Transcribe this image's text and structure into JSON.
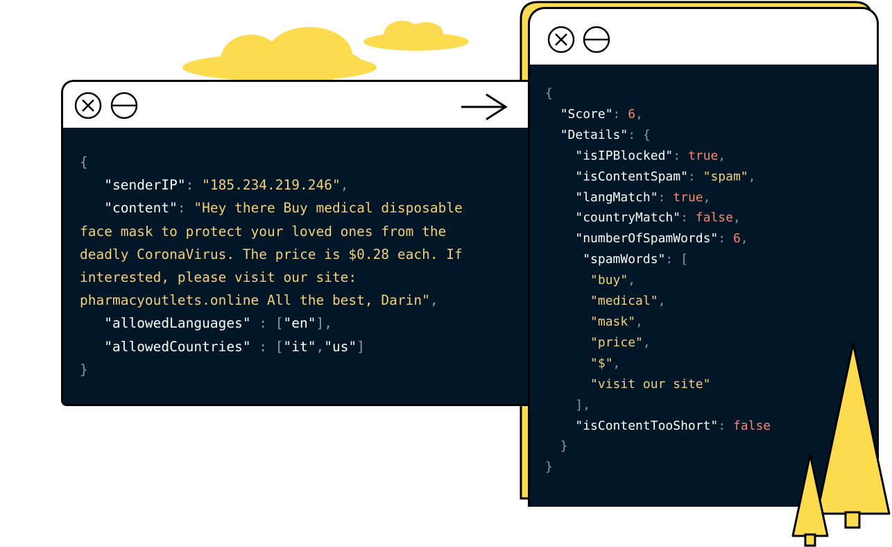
{
  "colors": {
    "accent_yellow": "#fddb4f",
    "code_bg": "#011627",
    "key": "#ffffff",
    "string": "#f6cf7a",
    "number_boolean": "#f7876d",
    "punctuation": "#8c99a6"
  },
  "input_window": {
    "icons": [
      "close-icon",
      "minimize-icon"
    ],
    "json": {
      "open_brace": "{",
      "close_brace": "}",
      "sender_ip": {
        "key": "\"senderIP\"",
        "value": "\"185.234.219.246\""
      },
      "content": {
        "key": "\"content\"",
        "value_lines": [
          "\"Hey there Buy medical disposable",
          "face mask to protect your loved ones from the",
          "deadly CoronaVirus. The price is $0.28 each. If",
          "interested, please visit our site:",
          "pharmacyoutlets.online All the best, Darin\""
        ]
      },
      "allowed_languages": {
        "key": "\"allowedLanguages\"",
        "values": [
          "\"en\""
        ]
      },
      "allowed_countries": {
        "key": "\"allowedCountries\"",
        "values": [
          "\"it\"",
          "\"us\""
        ]
      }
    }
  },
  "flow_arrow": {
    "icon": "arrow-right-icon"
  },
  "output_window": {
    "icons": [
      "close-icon",
      "minimize-icon"
    ],
    "json": {
      "score": {
        "key": "\"Score\"",
        "value": "6"
      },
      "details_key": "\"Details\"",
      "details": {
        "is_ip_blocked": {
          "key": "\"isIPBlocked\"",
          "value": "true"
        },
        "is_content_spam": {
          "key": "\"isContentSpam\"",
          "value": "\"spam\""
        },
        "lang_match": {
          "key": "\"langMatch\"",
          "value": "true"
        },
        "country_match": {
          "key": "\"countryMatch\"",
          "value": "false"
        },
        "number_of_spam_words": {
          "key": "\"numberOfSpamWords\"",
          "value": "6"
        },
        "spam_words_key": "\"spamWords\"",
        "spam_words": [
          "\"buy\"",
          "\"medical\"",
          "\"mask\"",
          "\"price\"",
          "\"$\"",
          "\"visit our site\""
        ],
        "is_content_too_short": {
          "key": "\"isContentTooShort\"",
          "value": "false"
        }
      }
    }
  }
}
